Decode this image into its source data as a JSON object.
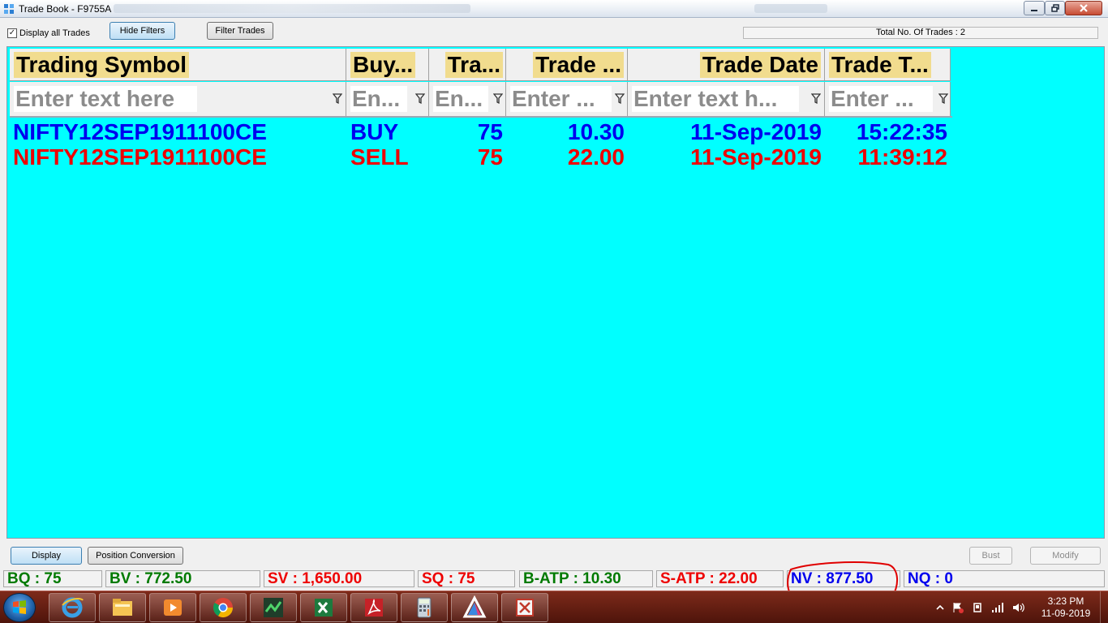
{
  "window": {
    "title": "Trade Book - F9755A"
  },
  "toolbar": {
    "display_all_label": "Display all Trades",
    "display_all_checked": "✓",
    "hide_filters_label": "Hide Filters",
    "filter_trades_label": "Filter Trades",
    "total_trades": "Total No. Of Trades : 2"
  },
  "grid": {
    "background": "#00ffff",
    "columns": [
      {
        "header": "Trading Symbol",
        "filter": "Enter text here"
      },
      {
        "header": "Buy...",
        "filter": "En..."
      },
      {
        "header": "Tra...",
        "filter": "En..."
      },
      {
        "header": "Trade ...",
        "filter": "Enter ..."
      },
      {
        "header": "Trade Date",
        "filter": "Enter text h..."
      },
      {
        "header": "Trade T...",
        "filter": "Enter ..."
      }
    ],
    "rows": [
      {
        "color": "#0000ee",
        "cells": [
          "NIFTY12SEP1911100CE",
          "BUY",
          "75",
          "10.30",
          "11-Sep-2019",
          "15:22:35"
        ]
      },
      {
        "color": "#ee0000",
        "cells": [
          "NIFTY12SEP1911100CE",
          "SELL",
          "75",
          "22.00",
          "11-Sep-2019",
          "11:39:12"
        ]
      }
    ]
  },
  "actions": {
    "display_label": "Display",
    "position_conversion_label": "Position Conversion",
    "bust_label": "Bust",
    "modify_label": "Modify"
  },
  "status_bar": [
    {
      "text": "BQ : 75",
      "color": "#007a00"
    },
    {
      "text": "BV : 772.50",
      "color": "#007a00"
    },
    {
      "text": "SV : 1,650.00",
      "color": "#ee0000"
    },
    {
      "text": "SQ : 75",
      "color": "#ee0000"
    },
    {
      "text": "B-ATP : 10.30",
      "color": "#007a00"
    },
    {
      "text": "S-ATP : 22.00",
      "color": "#ee0000"
    },
    {
      "text": "NV : 877.50",
      "color": "#0000ee"
    },
    {
      "text": "NQ : 0",
      "color": "#0000ee"
    }
  ],
  "taskbar": {
    "items": [
      "internet-explorer-icon",
      "file-explorer-icon",
      "media-player-icon",
      "chrome-icon",
      "trading-app-icon",
      "excel-icon",
      "acrobat-icon",
      "calculator-icon",
      "prism-app-icon",
      "snipping-tool-icon"
    ],
    "clock_time": "3:23 PM",
    "clock_date": "11-09-2019"
  },
  "colors": {
    "annotation_circle": "#e00000",
    "taskbar": "#6a1f12"
  }
}
